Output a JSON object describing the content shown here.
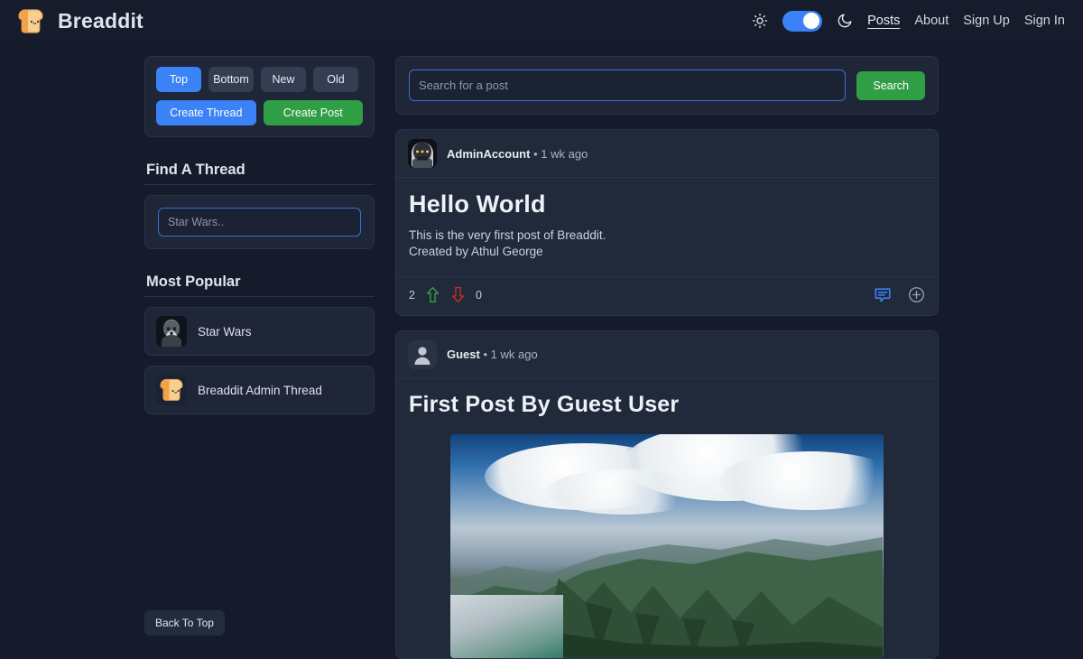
{
  "header": {
    "brand": "Breaddit",
    "brand_logo_icon": "bread-logo-icon",
    "sun_icon": "sun-icon",
    "moon_icon": "moon-icon",
    "theme_toggle_state": "on",
    "nav": [
      {
        "label": "Posts",
        "active": true
      },
      {
        "label": "About",
        "active": false
      },
      {
        "label": "Sign Up",
        "active": false
      },
      {
        "label": "Sign In",
        "active": false
      }
    ]
  },
  "sidebar": {
    "sort_buttons": [
      {
        "label": "Top",
        "active": true
      },
      {
        "label": "Bottom",
        "active": false
      },
      {
        "label": "New",
        "active": false
      },
      {
        "label": "Old",
        "active": false
      }
    ],
    "create_thread_label": "Create Thread",
    "create_post_label": "Create Post",
    "find_thread_title": "Find A Thread",
    "find_thread_placeholder": "Star Wars..",
    "find_thread_value": "",
    "most_popular_title": "Most Popular",
    "threads": [
      {
        "name": "Star Wars",
        "avatar_icon": "stormtrooper-avatar-icon"
      },
      {
        "name": "Breaddit Admin Thread",
        "avatar_icon": "bread-logo-icon"
      }
    ],
    "back_to_top_label": "Back To Top"
  },
  "search": {
    "placeholder": "Search for a post",
    "value": "",
    "button_label": "Search"
  },
  "posts": [
    {
      "author": "AdminAccount",
      "separator": "•",
      "time": "1 wk ago",
      "avatar_icon": "admin-account-avatar-icon",
      "title": "Hello World",
      "text_line1": "This is the very first post of Breaddit.",
      "text_line2": "Created by Athul George",
      "upvotes": "2",
      "downvotes": "0",
      "upvote_icon": "arrow-up-icon",
      "downvote_icon": "arrow-down-icon",
      "comment_icon": "comment-icon",
      "add_icon": "plus-circle-icon"
    },
    {
      "author": "Guest",
      "separator": "•",
      "time": "1 wk ago",
      "avatar_icon": "guest-person-avatar-icon",
      "title": "First Post By Guest User",
      "image_alt": "coastal-mountain-photo"
    }
  ],
  "colors": {
    "page_bg": "#151b2b",
    "panel_bg": "#1e2637",
    "post_bg": "#212a3a",
    "accent_blue": "#3b82f6",
    "accent_green": "#2f9e44",
    "upvote_green": "#2f9e44",
    "downvote_red": "#c92a2a"
  }
}
